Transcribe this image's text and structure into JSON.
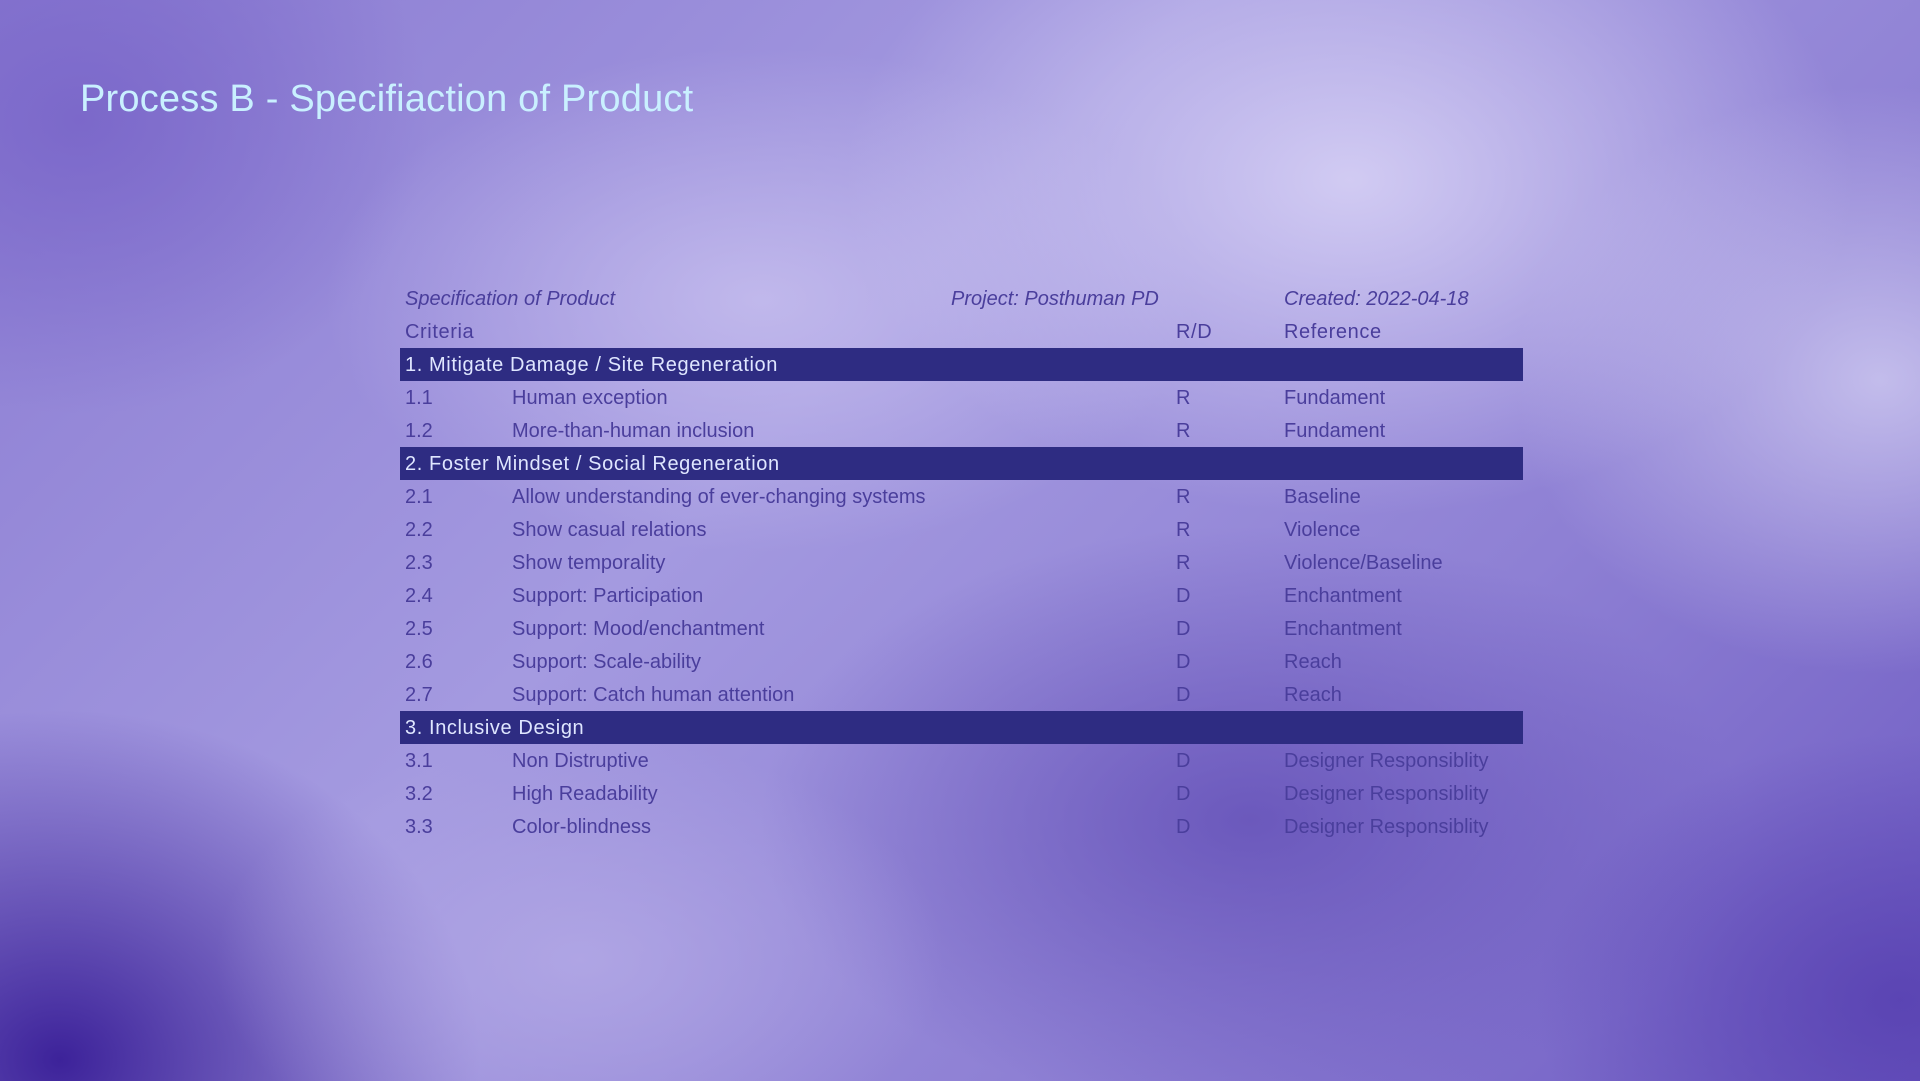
{
  "slide": {
    "title": "Process B - Specifiaction of Product"
  },
  "table": {
    "meta": {
      "name": "Specification of Product",
      "project": "Project: Posthuman PD",
      "created": "Created: 2022-04-18"
    },
    "headers": {
      "criteria": "Criteria",
      "rd": "R/D",
      "reference": "Reference"
    },
    "sections": [
      {
        "title": "1. Mitigate Damage / Site Regeneration",
        "rows": [
          {
            "num": "1.1",
            "criteria": "Human exception",
            "rd": "R",
            "reference": "Fundament"
          },
          {
            "num": "1.2",
            "criteria": "More-than-human inclusion",
            "rd": "R",
            "reference": "Fundament"
          }
        ]
      },
      {
        "title": "2. Foster Mindset / Social Regeneration",
        "rows": [
          {
            "num": "2.1",
            "criteria": "Allow understanding of ever-changing systems",
            "rd": "R",
            "reference": "Baseline"
          },
          {
            "num": "2.2",
            "criteria": "Show casual relations",
            "rd": "R",
            "reference": "Violence"
          },
          {
            "num": "2.3",
            "criteria": "Show temporality",
            "rd": "R",
            "reference": "Violence/Baseline"
          },
          {
            "num": "2.4",
            "criteria": "Support: Participation",
            "rd": "D",
            "reference": "Enchantment"
          },
          {
            "num": "2.5",
            "criteria": "Support: Mood/enchantment",
            "rd": "D",
            "reference": "Enchantment"
          },
          {
            "num": "2.6",
            "criteria": "Support: Scale-ability",
            "rd": "D",
            "reference": "Reach"
          },
          {
            "num": "2.7",
            "criteria": "Support: Catch human attention",
            "rd": "D",
            "reference": "Reach"
          }
        ]
      },
      {
        "title": "3. Inclusive Design",
        "rows": [
          {
            "num": "3.1",
            "criteria": "Non Distruptive",
            "rd": "D",
            "reference": "Designer Responsiblity"
          },
          {
            "num": "3.2",
            "criteria": "High Readability",
            "rd": "D",
            "reference": "Designer Responsiblity"
          },
          {
            "num": "3.3",
            "criteria": "Color-blindness",
            "rd": "D",
            "reference": "Designer Responsiblity"
          }
        ]
      }
    ]
  }
}
